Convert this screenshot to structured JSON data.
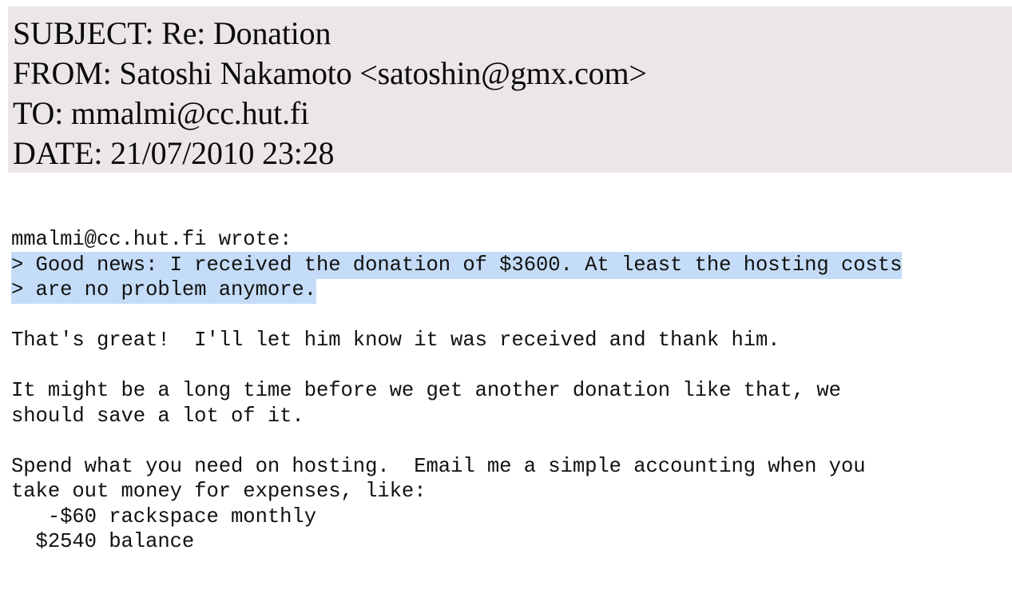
{
  "document": {
    "kind": "email-message",
    "colors": {
      "header_background": "#ebe7e6",
      "page_background": "#ffffff",
      "highlight": "#c4dcf7",
      "text": "#111111"
    }
  },
  "header": {
    "subject_line": "SUBJECT: Re: Donation",
    "from_line": "FROM: Satoshi Nakamoto <satoshin@gmx.com>",
    "to_line": "TO: mmalmi@cc.hut.fi",
    "date_line": "DATE: 21/07/2010 23:28",
    "fields": {
      "subject_label": "SUBJECT:",
      "subject_value": "Re: Donation",
      "from_label": "FROM:",
      "from_value": "Satoshi Nakamoto <satoshin@gmx.com>",
      "to_label": "TO:",
      "to_value": "mmalmi@cc.hut.fi",
      "date_label": "DATE:",
      "date_value": "21/07/2010 23:28"
    }
  },
  "body": {
    "attribution_line": "mmalmi@cc.hut.fi wrote:",
    "quote": {
      "highlighted": true,
      "lines": [
        "> Good news: I received the donation of $3600. At least the hosting costs",
        "> are no problem anymore."
      ]
    },
    "paragraphs": [
      {
        "lines": [
          "That's great!  I'll let him know it was received and thank him."
        ]
      },
      {
        "lines": [
          "It might be a long time before we get another donation like that, we",
          "should save a lot of it."
        ]
      },
      {
        "lines": [
          "Spend what you need on hosting.  Email me a simple accounting when you",
          "take out money for expenses, like:",
          "   -$60 rackspace monthly",
          "  $2540 balance"
        ]
      }
    ]
  }
}
